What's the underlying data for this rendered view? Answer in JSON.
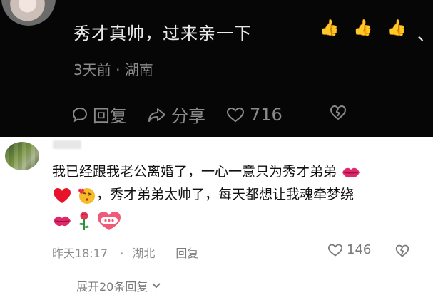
{
  "top_comment": {
    "text": "秀才真帅，过来亲一下",
    "trailing": "、",
    "meta": "3天前 · 湖南",
    "reply_label": "回复",
    "share_label": "分享",
    "like_count": "716",
    "icons": [
      "thumbs-up-icon",
      "thumbs-up-icon",
      "thumbs-up-icon",
      "comment-bubble-icon",
      "share-icon",
      "heart-icon",
      "dislike-heart-icon"
    ]
  },
  "reply_comment": {
    "line1": "我已经跟我老公离婚了，一心一意只为秀才弟弟",
    "line2": "，秀才弟弟太帅了，每天都想让我魂牵梦绕",
    "time": "昨天18:17",
    "location": "湖北",
    "reply_label": "回复",
    "like_count": "146",
    "icons": [
      "lips-icon",
      "red-heart-icon",
      "kissing-face-icon",
      "lips-icon",
      "rose-icon",
      "jiayou-sticker-icon",
      "heart-icon",
      "dislike-heart-icon"
    ]
  },
  "expand_replies": "展开20条回复",
  "colors": {
    "dark_bg": "#060606",
    "light_bg": "#ffffff",
    "muted": "#8a8a8a"
  }
}
